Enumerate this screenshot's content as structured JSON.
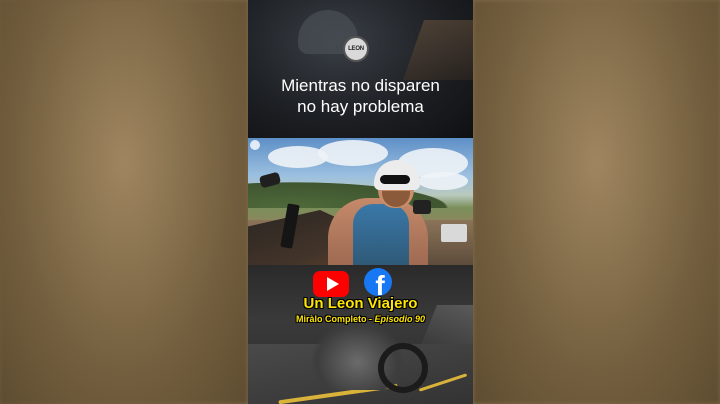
{
  "overlay": {
    "caption_line1": "Mientras no disparen",
    "caption_line2": "no hay problema"
  },
  "logo": {
    "text": "LEON"
  },
  "social": {
    "youtube_icon": "youtube-icon",
    "facebook_icon": "facebook-icon",
    "facebook_glyph": "f"
  },
  "branding": {
    "title": "Un Leon Viajero",
    "subtitle_prefix": "Miràlo Completo - ",
    "subtitle_episode": "Episodio 90"
  },
  "colors": {
    "title_yellow": "#ffe600",
    "youtube_red": "#ff0000",
    "facebook_blue": "#1877f2"
  }
}
